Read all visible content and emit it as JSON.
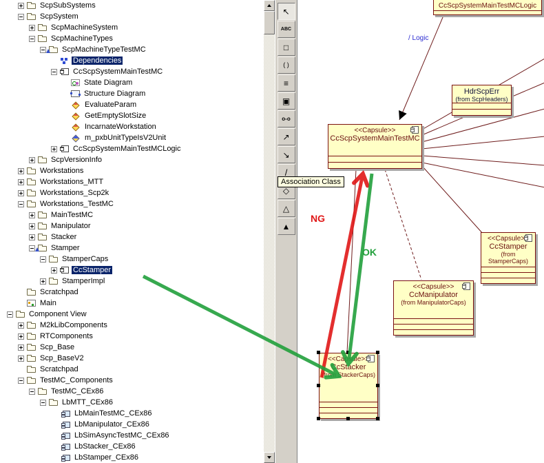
{
  "tree": {
    "items": [
      {
        "label": "ScpSubSystems",
        "depth": 1,
        "exp": "plus",
        "icon": "folder"
      },
      {
        "label": "ScpSystem",
        "depth": 1,
        "exp": "minus",
        "icon": "folder"
      },
      {
        "label": "ScpMachineSystem",
        "depth": 2,
        "exp": "plus",
        "icon": "folder"
      },
      {
        "label": "ScpMachineTypes",
        "depth": 2,
        "exp": "minus",
        "icon": "folder"
      },
      {
        "label": "ScpMachineTypeTestMC",
        "depth": 3,
        "exp": "minus",
        "icon": "folder-unit"
      },
      {
        "label": "Dependencies",
        "depth": 4,
        "exp": "none",
        "icon": "dependencies",
        "sel": true
      },
      {
        "label": "CcScpSystemMainTestMC",
        "depth": 4,
        "exp": "minus",
        "icon": "capsule"
      },
      {
        "label": "State Diagram",
        "depth": 5,
        "exp": "none",
        "icon": "state-diagram"
      },
      {
        "label": "Structure Diagram",
        "depth": 5,
        "exp": "none",
        "icon": "structure-diagram"
      },
      {
        "label": "EvaluateParam",
        "depth": 5,
        "exp": "none",
        "icon": "operation"
      },
      {
        "label": "GetEmptySlotSize",
        "depth": 5,
        "exp": "none",
        "icon": "operation"
      },
      {
        "label": "IncarnateWorkstation",
        "depth": 5,
        "exp": "none",
        "icon": "operation"
      },
      {
        "label": "m_pxbUnitTypeIsV2Unit",
        "depth": 5,
        "exp": "none",
        "icon": "attribute"
      },
      {
        "label": "CcScpSystemMainTestMCLogic",
        "depth": 4,
        "exp": "plus",
        "icon": "capsule"
      },
      {
        "label": "ScpVersionInfo",
        "depth": 2,
        "exp": "plus",
        "icon": "folder"
      },
      {
        "label": "Workstations",
        "depth": 1,
        "exp": "plus",
        "icon": "folder"
      },
      {
        "label": "Workstations_MTT",
        "depth": 1,
        "exp": "plus",
        "icon": "folder"
      },
      {
        "label": "Workstations_Scp2k",
        "depth": 1,
        "exp": "plus",
        "icon": "folder"
      },
      {
        "label": "Workstations_TestMC",
        "depth": 1,
        "exp": "minus",
        "icon": "folder"
      },
      {
        "label": "MainTestMC",
        "depth": 2,
        "exp": "plus",
        "icon": "folder"
      },
      {
        "label": "Manipulator",
        "depth": 2,
        "exp": "plus",
        "icon": "folder"
      },
      {
        "label": "Stacker",
        "depth": 2,
        "exp": "plus",
        "icon": "folder"
      },
      {
        "label": "Stamper",
        "depth": 2,
        "exp": "minus",
        "icon": "folder-unit"
      },
      {
        "label": "StamperCaps",
        "depth": 3,
        "exp": "minus",
        "icon": "folder"
      },
      {
        "label": "CcStamper",
        "depth": 4,
        "exp": "plus",
        "icon": "capsule",
        "sel": true
      },
      {
        "label": "StamperImpl",
        "depth": 3,
        "exp": "plus",
        "icon": "folder"
      },
      {
        "label": "Scratchpad",
        "depth": 1,
        "exp": "none",
        "icon": "folder"
      },
      {
        "label": "Main",
        "depth": 1,
        "exp": "none",
        "icon": "diagram"
      },
      {
        "label": "Component View",
        "depth": 0,
        "exp": "minus",
        "icon": "folder"
      },
      {
        "label": "M2kLibComponents",
        "depth": 1,
        "exp": "plus",
        "icon": "folder"
      },
      {
        "label": "RTComponents",
        "depth": 1,
        "exp": "plus",
        "icon": "folder"
      },
      {
        "label": "Scp_Base",
        "depth": 1,
        "exp": "plus",
        "icon": "folder"
      },
      {
        "label": "Scp_BaseV2",
        "depth": 1,
        "exp": "plus",
        "icon": "folder"
      },
      {
        "label": "Scratchpad",
        "depth": 1,
        "exp": "none",
        "icon": "folder"
      },
      {
        "label": "TestMC_Components",
        "depth": 1,
        "exp": "minus",
        "icon": "folder"
      },
      {
        "label": "TestMC_CEx86",
        "depth": 2,
        "exp": "minus",
        "icon": "folder"
      },
      {
        "label": "LbMTT_CEx86",
        "depth": 3,
        "exp": "minus",
        "icon": "folder"
      },
      {
        "label": "LbMainTestMC_CEx86",
        "depth": 4,
        "exp": "none",
        "icon": "component"
      },
      {
        "label": "LbManipulator_CEx86",
        "depth": 4,
        "exp": "none",
        "icon": "component"
      },
      {
        "label": "LbSimAsyncTestMC_CEx86",
        "depth": 4,
        "exp": "none",
        "icon": "component"
      },
      {
        "label": "LbStacker_CEx86",
        "depth": 4,
        "exp": "none",
        "icon": "component"
      },
      {
        "label": "LbStamper_CEx86",
        "depth": 4,
        "exp": "none",
        "icon": "component"
      }
    ]
  },
  "toolbar": {
    "tools": [
      {
        "name": "pointer-tool",
        "glyph": "↖",
        "pressed": true
      },
      {
        "name": "text-tool",
        "glyph": "ABC"
      },
      {
        "name": "note-tool",
        "glyph": "□"
      },
      {
        "name": "collaboration-tool",
        "glyph": "( )"
      },
      {
        "name": "list-tool",
        "glyph": "≡"
      },
      {
        "name": "package-tool",
        "glyph": "▣"
      },
      {
        "name": "connector-tool",
        "glyph": "o-o"
      },
      {
        "name": "dependency-tool",
        "glyph": "↗"
      },
      {
        "name": "association-tool",
        "glyph": "↘"
      },
      {
        "name": "association-class-tool",
        "glyph": "/"
      },
      {
        "name": "aggregation-tool",
        "glyph": "◇"
      },
      {
        "name": "inheritance-tool",
        "glyph": "△"
      },
      {
        "name": "realize-tool",
        "glyph": "▲"
      }
    ]
  },
  "tooltip": {
    "text": "Association Class"
  },
  "canvas": {
    "top_box": {
      "name": "CcScpSystemMainTestMCLogic"
    },
    "class_box": {
      "name": "HdrScpErr",
      "from": "(from ScpHeaders)"
    },
    "capsules": [
      {
        "stereotype": "<<Capsule>>",
        "name": "CcScpSystemMainTestMC",
        "from": ""
      },
      {
        "stereotype": "<<Capsule>>",
        "name": "CcStamper",
        "from": "(from StamperCaps)"
      },
      {
        "stereotype": "<<Capsule>>",
        "name": "CcManipulator",
        "from": "(from ManipulatorCaps)"
      },
      {
        "stereotype": "<<Capsule>>",
        "name": "CcStacker",
        "from": "(from StackerCaps)"
      }
    ],
    "edge_label": "/ Logic",
    "annotations": [
      {
        "text": "NG",
        "color": "#e01818"
      },
      {
        "text": "OK",
        "color": "#22a03c"
      }
    ],
    "colors": {
      "box_fill": "#ffffc6",
      "box_border": "#7a1010",
      "selection": "#0a246a"
    }
  }
}
